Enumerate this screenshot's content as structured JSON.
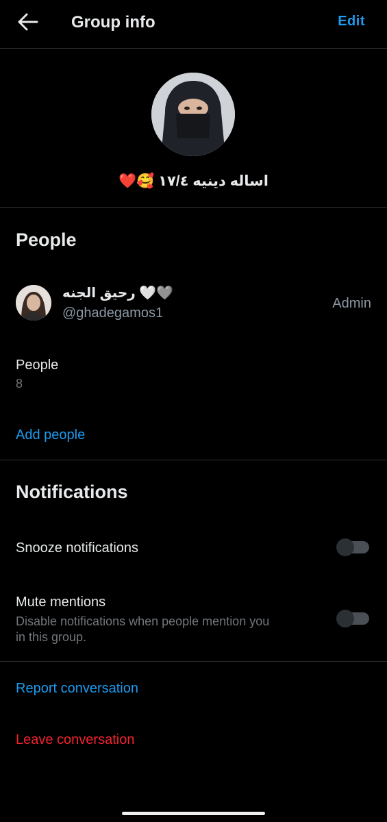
{
  "header": {
    "title": "Group info",
    "edit_label": "Edit",
    "back_icon": "arrow-left-icon"
  },
  "group": {
    "name": "اساله دينيه ١٧/٤ 🥰❤️"
  },
  "people_section": {
    "title": "People",
    "member": {
      "name": "رحيق الجنه 🤍🩶",
      "handle": "@ghadegamos1",
      "role": "Admin"
    },
    "count_label": "People",
    "count_value": "8",
    "add_label": "Add people"
  },
  "notifications": {
    "title": "Notifications",
    "snooze_label": "Snooze notifications",
    "snooze_on": false,
    "mute_label": "Mute mentions",
    "mute_desc_line1": "Disable notifications when people mention you",
    "mute_desc_line2": "in this group.",
    "mute_on": false
  },
  "actions": {
    "report": "Report conversation",
    "leave": "Leave conversation"
  },
  "colors": {
    "accent": "#1d9bf0",
    "danger": "#f4212e",
    "background": "#000000"
  }
}
